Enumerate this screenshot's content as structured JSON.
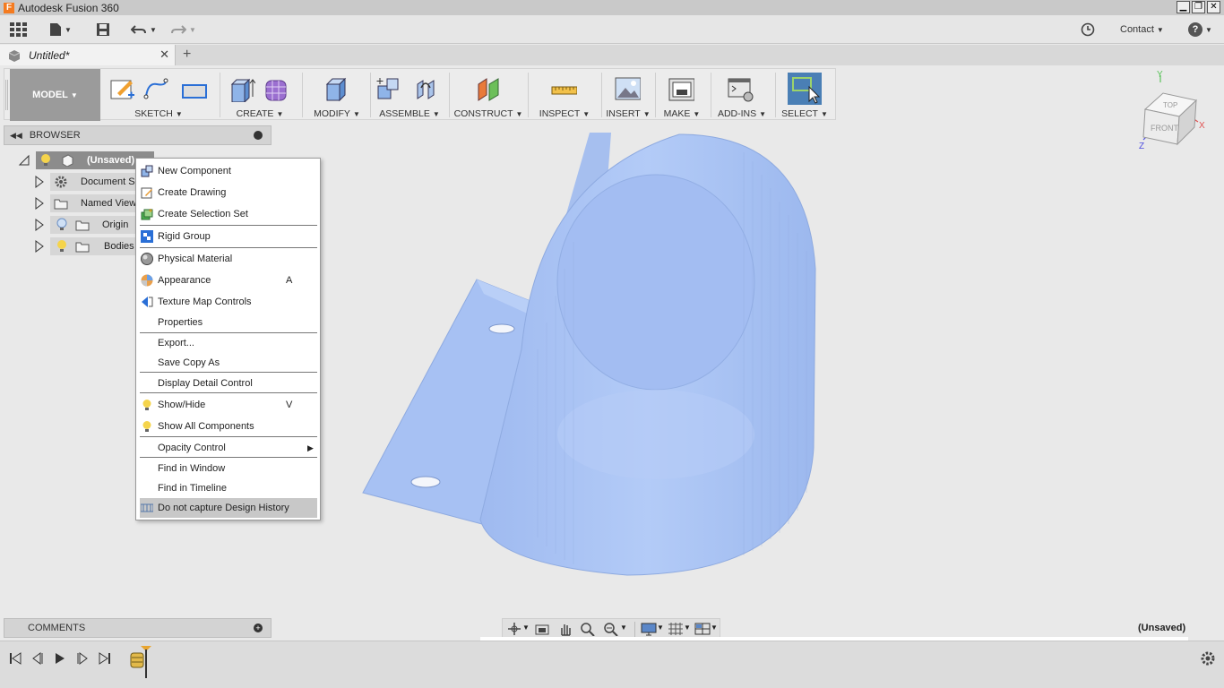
{
  "window": {
    "title": "Autodesk Fusion 360",
    "logo_letter": "F"
  },
  "quick_access": {
    "contact_label": "Contact",
    "help_label": "?"
  },
  "tabs": [
    {
      "label": "Untitled*"
    }
  ],
  "new_tab_label": "+",
  "ribbon": {
    "workspace_label": "MODEL",
    "groups": [
      {
        "label": "SKETCH"
      },
      {
        "label": "CREATE"
      },
      {
        "label": "MODIFY"
      },
      {
        "label": "ASSEMBLE"
      },
      {
        "label": "CONSTRUCT"
      },
      {
        "label": "INSPECT"
      },
      {
        "label": "INSERT"
      },
      {
        "label": "MAKE"
      },
      {
        "label": "ADD-INS"
      },
      {
        "label": "SELECT"
      }
    ]
  },
  "browser": {
    "header_label": "BROWSER",
    "root_label": "(Unsaved)",
    "nodes": [
      {
        "label": "Document Se"
      },
      {
        "label": "Named View"
      },
      {
        "label": "Origin"
      },
      {
        "label": "Bodies"
      }
    ]
  },
  "context_menu": {
    "items": [
      {
        "label": "New Component",
        "icon": "new-component-icon"
      },
      {
        "label": "Create Drawing",
        "icon": "create-drawing-icon"
      },
      {
        "label": "Create Selection Set",
        "icon": "selection-set-icon"
      },
      {
        "label": "Rigid Group",
        "icon": "rigid-group-icon"
      },
      {
        "label": "Physical Material",
        "icon": "physical-material-icon"
      },
      {
        "label": "Appearance",
        "icon": "appearance-icon",
        "shortcut": "A"
      },
      {
        "label": "Texture Map Controls",
        "icon": "texture-map-icon"
      },
      {
        "label": "Properties",
        "icon": ""
      },
      {
        "label": "Export...",
        "icon": ""
      },
      {
        "label": "Save Copy As",
        "icon": ""
      },
      {
        "label": "Display Detail Control",
        "icon": ""
      },
      {
        "label": "Show/Hide",
        "icon": "lightbulb-icon",
        "shortcut": "V"
      },
      {
        "label": "Show All Components",
        "icon": "lightbulb-icon"
      },
      {
        "label": "Opacity Control",
        "icon": "",
        "submenu": true
      },
      {
        "label": "Find in Window",
        "icon": ""
      },
      {
        "label": "Find in Timeline",
        "icon": ""
      },
      {
        "label": "Do not capture Design History",
        "icon": "design-history-icon"
      }
    ]
  },
  "comments": {
    "label": "COMMENTS"
  },
  "status": {
    "document_state": "(Unsaved)"
  },
  "viewcube": {
    "top_label": "TOP",
    "front_label": "FRONT",
    "axis_x": "X",
    "axis_y": "Y",
    "axis_z": "Z"
  },
  "colors": {
    "model_fill": "#a9c4f5",
    "accent_select": "#4a7fb5",
    "workspace_bg": "#9b9b9b"
  }
}
